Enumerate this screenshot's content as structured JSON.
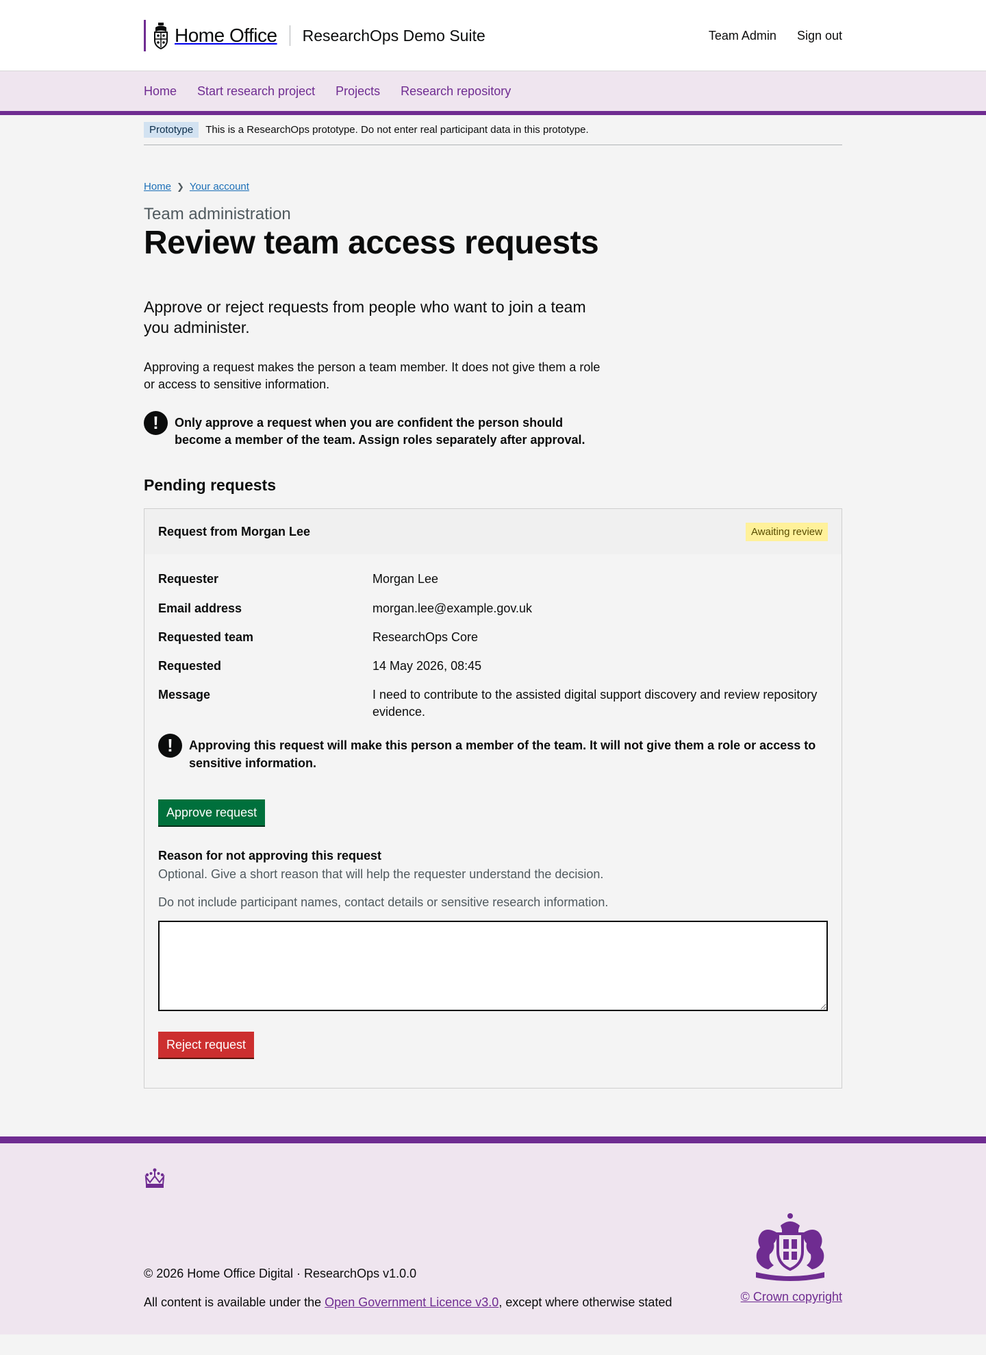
{
  "header": {
    "logo_text": "Home Office",
    "service_name": "ResearchOps Demo Suite",
    "links": [
      "Team Admin",
      "Sign out"
    ]
  },
  "nav": {
    "items": [
      "Home",
      "Start research project",
      "Projects",
      "Research repository"
    ]
  },
  "phase_banner": {
    "tag": "Prototype",
    "text": "This is a ResearchOps prototype. Do not enter real participant data in this prototype."
  },
  "breadcrumb": [
    "Home",
    "Your account"
  ],
  "page": {
    "caption": "Team administration",
    "title": "Review team access requests",
    "lead": "Approve or reject requests from people who want to join a team you administer.",
    "body": "Approving a request makes the person a team member. It does not give them a role or access to sensitive information.",
    "warning": "Only approve a request when you are confident the person should become a member of the team. Assign roles separately after approval.",
    "section_heading": "Pending requests"
  },
  "request": {
    "title": "Request from Morgan Lee",
    "status": "Awaiting review",
    "rows": [
      {
        "key": "Requester",
        "value": "Morgan Lee"
      },
      {
        "key": "Email address",
        "value": "morgan.lee@example.gov.uk"
      },
      {
        "key": "Requested team",
        "value": "ResearchOps Core"
      },
      {
        "key": "Requested",
        "value": "14 May 2026, 08:45"
      },
      {
        "key": "Message",
        "value": "I need to contribute to the assisted digital support discovery and review repository evidence."
      }
    ],
    "warning": "Approving this request will make this person a member of the team. It will not give them a role or access to sensitive information.",
    "approve_label": "Approve request",
    "reason_label": "Reason for not approving this request",
    "reason_hint_1": "Optional. Give a short reason that will help the requester understand the decision.",
    "reason_hint_2": "Do not include participant names, contact details or sensitive research information.",
    "reason_value": "",
    "reject_label": "Reject request"
  },
  "warning_icon": "!",
  "footer": {
    "meta_line": "© 2026 Home Office Digital · ResearchOps v1.0.0",
    "licence_prefix": "All content is available under the ",
    "licence_link": "Open Government Licence v3.0",
    "licence_suffix": ", except where otherwise stated",
    "copyright": "© Crown copyright"
  },
  "colors": {
    "brand": "#6f2c91",
    "approve": "#00703c",
    "reject": "#cc2f2f",
    "status": "#fff19a",
    "phase_tag": "#d2e2f1"
  },
  "icons": [
    "crest-icon",
    "chevron-right-icon",
    "warning-icon",
    "crown-icon",
    "royal-coat-of-arms-icon"
  ]
}
